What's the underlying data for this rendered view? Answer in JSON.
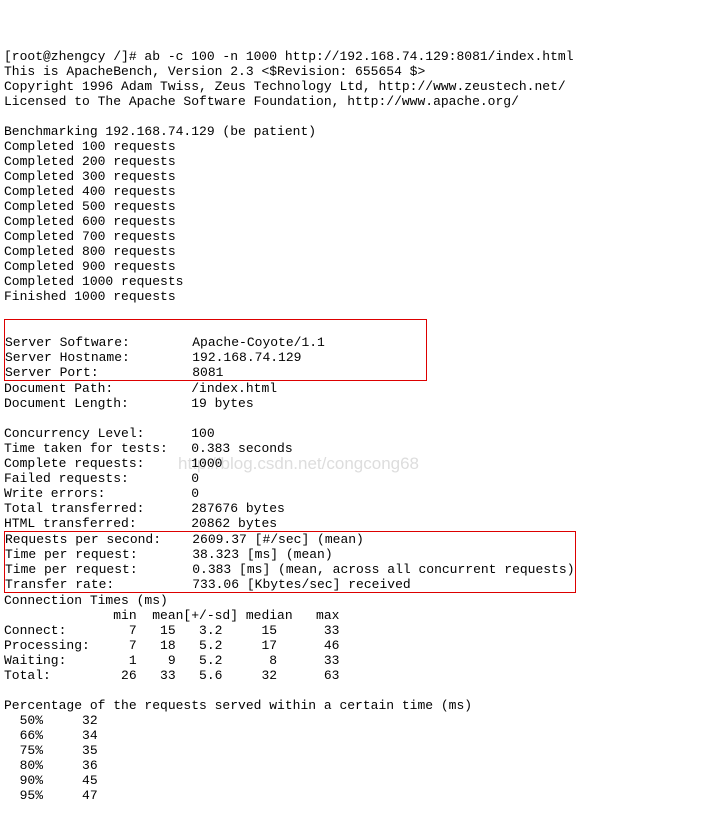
{
  "watermark": "http://blog.csdn.net/congcong68",
  "header": {
    "prompt": "[root@zhengcy /]# ab -c 100 -n 1000 http://192.168.74.129:8081/index.html",
    "l1": "This is ApacheBench, Version 2.3 <$Revision: 655654 $>",
    "l2": "Copyright 1996 Adam Twiss, Zeus Technology Ltd, http://www.zeustech.net/",
    "l3": "Licensed to The Apache Software Foundation, http://www.apache.org/"
  },
  "bench": "Benchmarking 192.168.74.129 (be patient)",
  "completed": [
    "Completed 100 requests",
    "Completed 200 requests",
    "Completed 300 requests",
    "Completed 400 requests",
    "Completed 500 requests",
    "Completed 600 requests",
    "Completed 700 requests",
    "Completed 800 requests",
    "Completed 900 requests",
    "Completed 1000 requests",
    "Finished 1000 requests"
  ],
  "server": {
    "software": "Server Software:        Apache-Coyote/1.1",
    "hostname": "Server Hostname:        192.168.74.129",
    "port": "Server Port:            8081"
  },
  "doc": {
    "path": "Document Path:          /index.html",
    "len": "Document Length:        19 bytes"
  },
  "stats": {
    "conc": "Concurrency Level:      100",
    "time": "Time taken for tests:   0.383 seconds",
    "comp": "Complete requests:      1000",
    "fail": "Failed requests:        0",
    "write": "Write errors:           0",
    "total": "Total transferred:      287676 bytes",
    "html": "HTML transferred:       20862 bytes"
  },
  "perf": {
    "rps": "Requests per second:    2609.37 [#/sec] (mean)",
    "tpr1": "Time per request:       38.323 [ms] (mean)",
    "tpr2": "Time per request:       0.383 [ms] (mean, across all concurrent requests)",
    "rate": "Transfer rate:          733.06 [Kbytes/sec] received"
  },
  "conn": {
    "title": "Connection Times (ms)",
    "hdr": "              min  mean[+/-sd] median   max",
    "connect": "Connect:        7   15   3.2     15      33",
    "processing": "Processing:     7   18   5.2     17      46",
    "waiting": "Waiting:        1    9   5.2      8      33",
    "total": "Total:         26   33   5.6     32      63"
  },
  "pct": {
    "title": "Percentage of the requests served within a certain time (ms)",
    "r50": "  50%     32",
    "r66": "  66%     34",
    "r75": "  75%     35",
    "r80": "  80%     36",
    "r90": "  90%     45",
    "r95": "  95%     47"
  }
}
